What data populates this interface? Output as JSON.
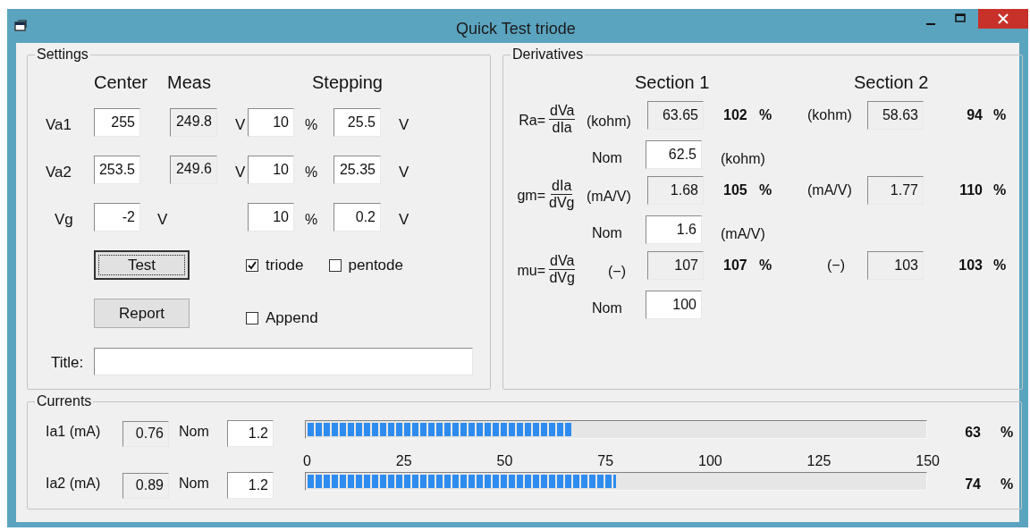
{
  "window": {
    "title": "Quick Test triode"
  },
  "settings": {
    "title": "Settings",
    "headers": [
      "Center",
      "Meas",
      "Stepping"
    ],
    "rows": [
      {
        "label": "Va1",
        "center": "255",
        "meas": "249.8",
        "meas_unit": "V",
        "step_pct": "10",
        "pct_unit": "%",
        "step_v": "25.5",
        "step_unit": "V"
      },
      {
        "label": "Va2",
        "center": "253.5",
        "meas": "249.6",
        "meas_unit": "V",
        "step_pct": "10",
        "pct_unit": "%",
        "step_v": "25.35",
        "step_unit": "V"
      },
      {
        "label": "Vg",
        "center": "-2",
        "center_unit": "V",
        "step_pct": "10",
        "pct_unit": "%",
        "step_v": "0.2",
        "step_unit": "V"
      }
    ],
    "buttons": [
      {
        "label": "Test",
        "focused": true
      },
      {
        "label": "Report",
        "focused": false
      }
    ],
    "checkboxes": [
      {
        "label": "triode",
        "checked": true
      },
      {
        "label": "pentode",
        "checked": false
      },
      {
        "label": "Append",
        "checked": false
      }
    ],
    "title_field": {
      "label": "Title:"
    }
  },
  "derivatives": {
    "title": "Derivatives",
    "section_headers": [
      "Section 1",
      "Section 2"
    ],
    "rows": [
      {
        "name": "Ra=",
        "numerator": "dVa",
        "denominator": "dIa",
        "unit": "(kohm)",
        "value": "63.65",
        "percent": "102",
        "sign": "%",
        "unit2": "(kohm)",
        "value2": "58.63",
        "percent2": "94",
        "sign2": "%",
        "nominal": {
          "label": "Nom",
          "value": "62.5",
          "unit": "(kohm)"
        }
      },
      {
        "name": "gm=",
        "numerator": "dIa",
        "denominator": "dVg",
        "unit": "(mA/V)",
        "value": "1.68",
        "percent": "105",
        "sign": "%",
        "unit2": "(mA/V)",
        "value2": "1.77",
        "percent2": "110",
        "sign2": "%",
        "nominal": {
          "label": "Nom",
          "value": "1.6",
          "unit": "(mA/V)"
        }
      },
      {
        "name": "mu=",
        "numerator": "dVa",
        "denominator": "dVg",
        "unit": "(−)",
        "value": "107",
        "percent": "107",
        "sign": "%",
        "unit2": "(−)",
        "value2": "103",
        "percent2": "103",
        "sign2": "%",
        "nominal": {
          "label": "Nom",
          "value": "100"
        }
      }
    ]
  },
  "currents": {
    "title": "Currents",
    "rows": [
      {
        "label": "Ia1 (mA)",
        "value": "0.76",
        "nom_label": "Nom",
        "nominal": "1.2",
        "level": 0.43,
        "percent": "63",
        "sign": "%"
      },
      {
        "label": "Ia2 (mA)",
        "value": "0.89",
        "nom_label": "Nom",
        "nominal": "1.2",
        "level": 0.5,
        "percent": "74",
        "sign": "%"
      }
    ],
    "scale": [
      "0",
      "25",
      "50",
      "75",
      "100",
      "125",
      "150"
    ]
  }
}
